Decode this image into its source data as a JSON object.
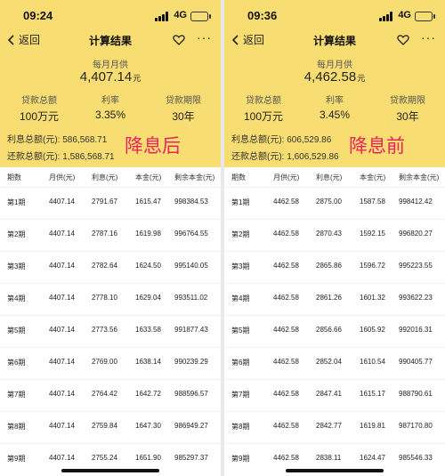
{
  "common": {
    "back_label": "返回",
    "title": "计算结果",
    "more": "···",
    "network": "4G",
    "monthly_label": "每月月供",
    "monthly_unit": "元",
    "loan_total_label": "贷款总额",
    "rate_label": "利率",
    "term_label": "贷款期限",
    "interest_total_label": "利息总额(元):",
    "repay_total_label": "还款总额(元):",
    "table_headers": [
      "期数",
      "月供(元)",
      "利息(元)",
      "本金(元)",
      "剩余本金(元)"
    ]
  },
  "left": {
    "time": "09:24",
    "monthly_value": "4,407.14",
    "loan_total": "100万元",
    "rate": "3.35%",
    "term": "30年",
    "interest_total": "586,568.71",
    "repay_total": "1,586,568.71",
    "stamp": "降息后",
    "rows": [
      [
        "第1期",
        "4407.14",
        "2791.67",
        "1615.47",
        "998384.53"
      ],
      [
        "第2期",
        "4407.14",
        "2787.16",
        "1619.98",
        "996764.55"
      ],
      [
        "第3期",
        "4407.14",
        "2782.64",
        "1624.50",
        "995140.05"
      ],
      [
        "第4期",
        "4407.14",
        "2778.10",
        "1629.04",
        "993511.02"
      ],
      [
        "第5期",
        "4407.14",
        "2773.56",
        "1633.58",
        "991877.43"
      ],
      [
        "第6期",
        "4407.14",
        "2769.00",
        "1638.14",
        "990239.29"
      ],
      [
        "第7期",
        "4407.14",
        "2764.42",
        "1642.72",
        "988596.57"
      ],
      [
        "第8期",
        "4407.14",
        "2759.84",
        "1647.30",
        "986949.27"
      ],
      [
        "第9期",
        "4407.14",
        "2755.24",
        "1651.90",
        "985297.37"
      ]
    ]
  },
  "right": {
    "time": "09:36",
    "monthly_value": "4,462.58",
    "loan_total": "100万元",
    "rate": "3.45%",
    "term": "30年",
    "interest_total": "606,529.86",
    "repay_total": "1,606,529.86",
    "stamp": "降息前",
    "rows": [
      [
        "第1期",
        "4462.58",
        "2875.00",
        "1587.58",
        "998412.42"
      ],
      [
        "第2期",
        "4462.58",
        "2870.43",
        "1592.15",
        "996820.27"
      ],
      [
        "第3期",
        "4462.58",
        "2865.86",
        "1596.72",
        "995223.55"
      ],
      [
        "第4期",
        "4462.58",
        "2861.26",
        "1601.32",
        "993622.23"
      ],
      [
        "第5期",
        "4462.58",
        "2856.66",
        "1605.92",
        "992016.31"
      ],
      [
        "第6期",
        "4462.58",
        "2852.04",
        "1610.54",
        "990405.77"
      ],
      [
        "第7期",
        "4462.58",
        "2847.41",
        "1615.17",
        "988790.61"
      ],
      [
        "第8期",
        "4462.58",
        "2842.77",
        "1619.81",
        "987170.80"
      ],
      [
        "第9期",
        "4462.58",
        "2838.11",
        "1624.47",
        "985546.33"
      ]
    ]
  },
  "colors": {
    "hero": "#f8dd72",
    "stamp": "#e8235f"
  }
}
